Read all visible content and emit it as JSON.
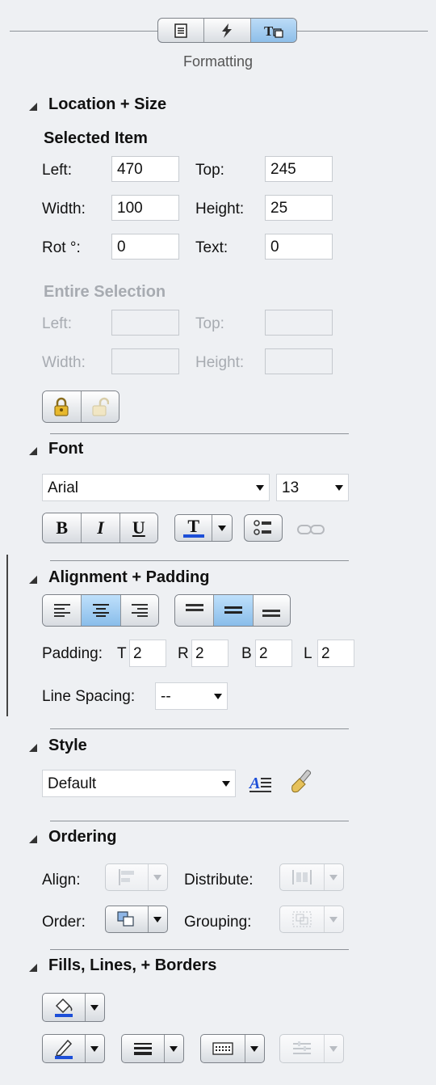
{
  "header": {
    "title": "Formatting",
    "tabs": [
      {
        "icon": "document-icon"
      },
      {
        "icon": "lightning-icon"
      },
      {
        "icon": "text-format-icon"
      }
    ]
  },
  "location_size": {
    "heading": "Location + Size",
    "selected_item": {
      "heading": "Selected Item",
      "left_label": "Left:",
      "left_value": "470",
      "top_label": "Top:",
      "top_value": "245",
      "width_label": "Width:",
      "width_value": "100",
      "height_label": "Height:",
      "height_value": "25",
      "rot_label": "Rot °:",
      "rot_value": "0",
      "text_label": "Text:",
      "text_value": "0"
    },
    "entire_selection": {
      "heading": "Entire Selection",
      "left_label": "Left:",
      "top_label": "Top:",
      "width_label": "Width:",
      "height_label": "Height:"
    }
  },
  "font": {
    "heading": "Font",
    "family": "Arial",
    "size": "13",
    "bold": "B",
    "italic": "I",
    "underline": "U",
    "text_color": "T"
  },
  "alignment": {
    "heading": "Alignment + Padding",
    "padding_label": "Padding:",
    "t_label": "T",
    "t_value": "2",
    "r_label": "R",
    "r_value": "2",
    "b_label": "B",
    "b_value": "2",
    "l_label": "L",
    "l_value": "2",
    "line_spacing_label": "Line Spacing:",
    "line_spacing_value": "--"
  },
  "style": {
    "heading": "Style",
    "value": "Default"
  },
  "ordering": {
    "heading": "Ordering",
    "align_label": "Align:",
    "distribute_label": "Distribute:",
    "order_label": "Order:",
    "grouping_label": "Grouping:"
  },
  "fills": {
    "heading": "Fills, Lines, + Borders"
  },
  "colors": {
    "accent": "#1d4fd8",
    "selected_tab": "#9ccaf0"
  }
}
